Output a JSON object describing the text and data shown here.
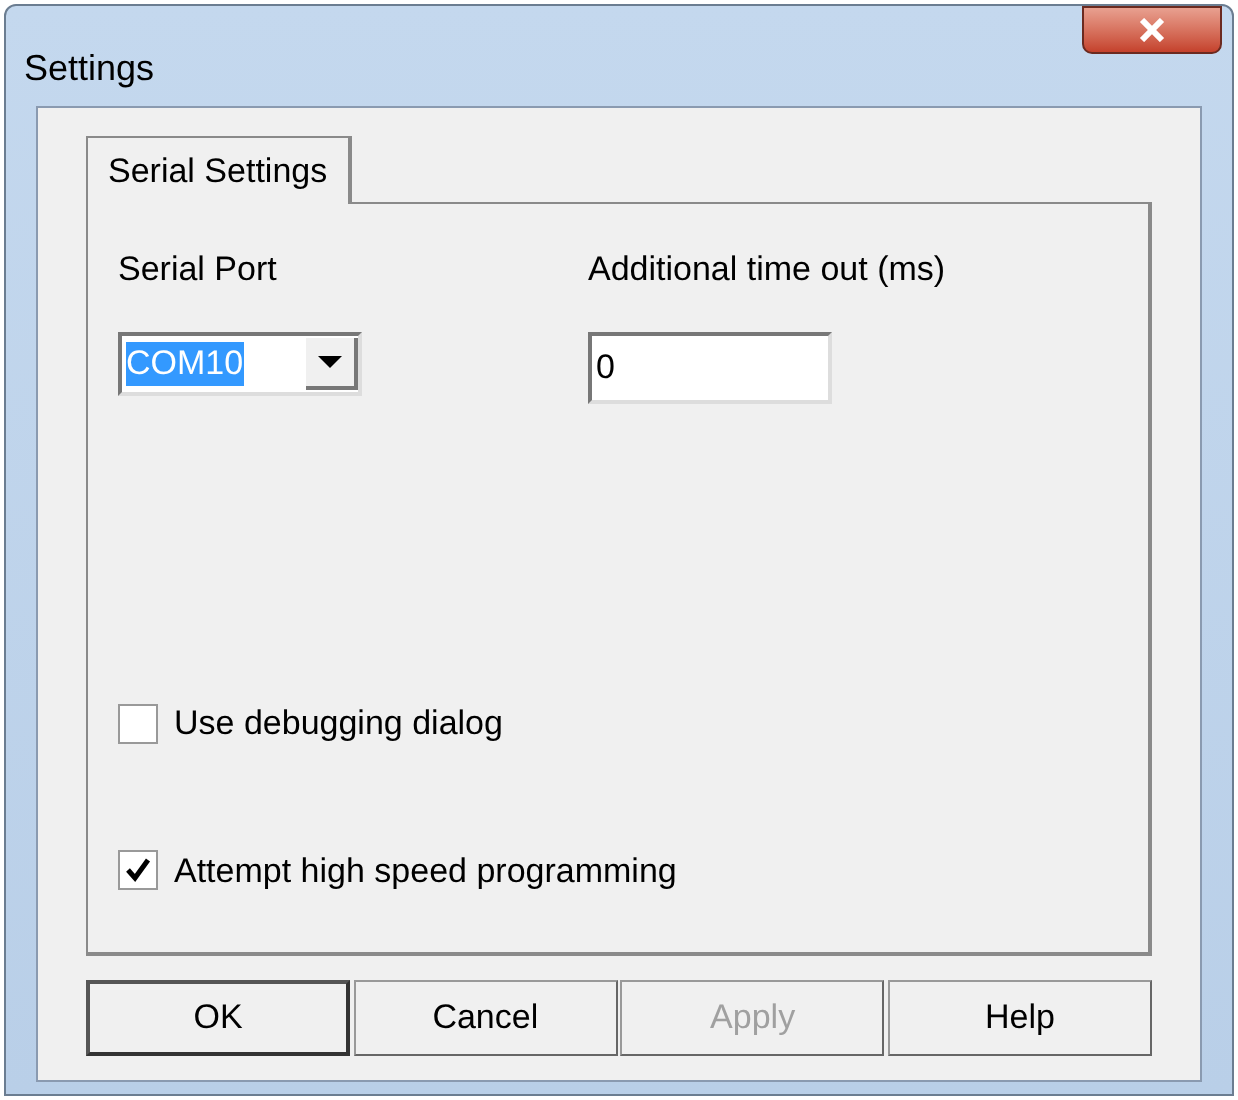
{
  "window": {
    "title": "Settings"
  },
  "tabs": [
    {
      "label": "Serial Settings",
      "selected": true
    }
  ],
  "serial_port": {
    "label": "Serial Port",
    "value": "COM10",
    "selected_text": true
  },
  "timeout": {
    "label": "Additional time out (ms)",
    "value": "0"
  },
  "checkboxes": [
    {
      "label": "Use debugging dialog",
      "checked": false
    },
    {
      "label": "Attempt high speed programming",
      "checked": true
    }
  ],
  "buttons": [
    {
      "label": "OK",
      "disabled": false,
      "default": true
    },
    {
      "label": "Cancel",
      "disabled": false,
      "default": false
    },
    {
      "label": "Apply",
      "disabled": true,
      "default": false
    },
    {
      "label": "Help",
      "disabled": false,
      "default": false
    }
  ]
}
